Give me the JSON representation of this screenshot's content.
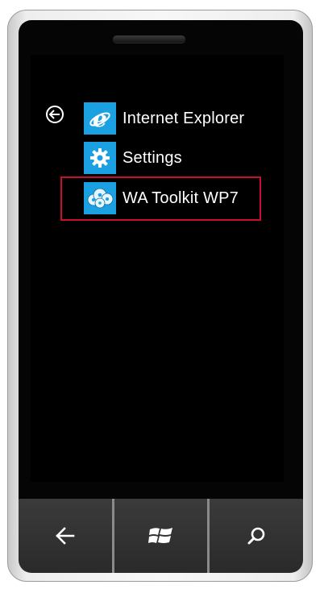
{
  "app_list": {
    "items": [
      {
        "label": "Internet Explorer",
        "icon": "internet-explorer-icon"
      },
      {
        "label": "Settings",
        "icon": "gear-icon"
      },
      {
        "label": "WA Toolkit WP7",
        "icon": "cloud-app-icon"
      }
    ],
    "back_icon": "back-arrow-circle-icon"
  },
  "hardware_buttons": [
    {
      "name": "back",
      "icon": "back-arrow-icon"
    },
    {
      "name": "start",
      "icon": "windows-logo-icon"
    },
    {
      "name": "search",
      "icon": "search-icon"
    }
  ],
  "colors": {
    "screen": "#000000",
    "tile_accent": "#1ba1e2",
    "highlight_border": "#c8102e",
    "text": "#ffffff"
  }
}
